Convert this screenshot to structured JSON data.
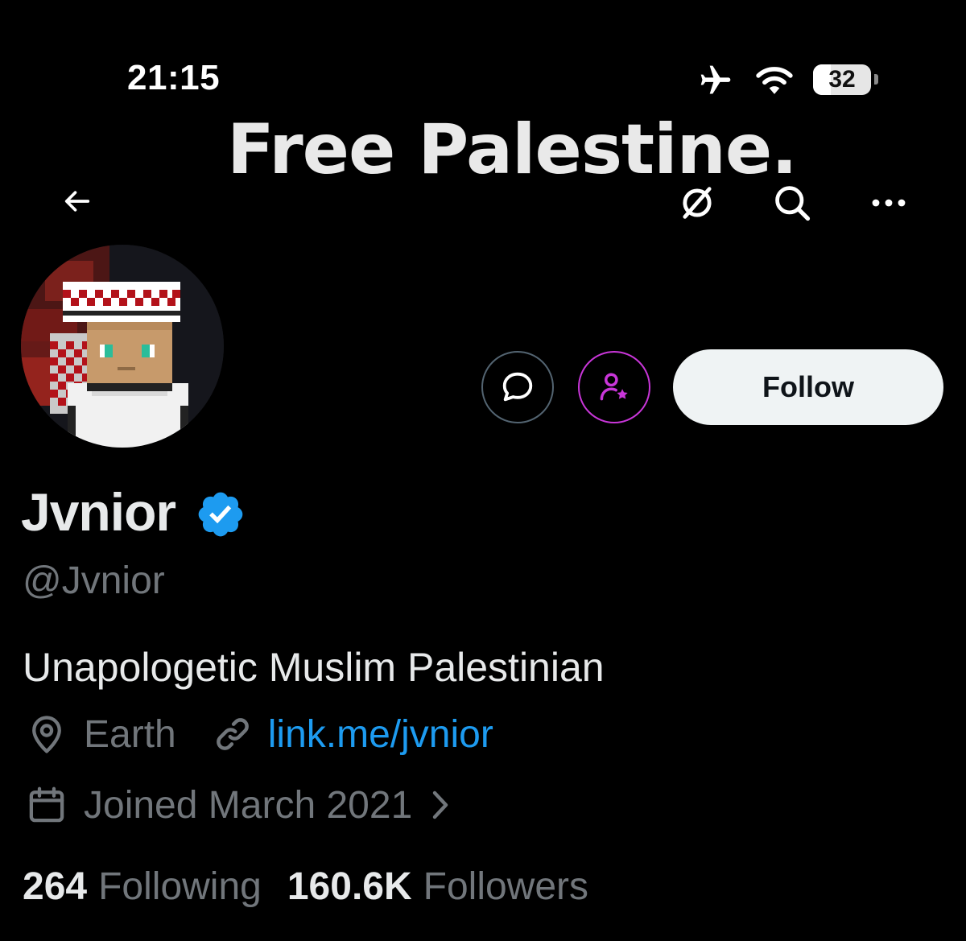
{
  "status_bar": {
    "time": "21:15",
    "battery": "32",
    "icons": [
      "airplane-icon",
      "wifi-icon",
      "battery-icon"
    ]
  },
  "banner": {
    "text": "Free Palestine."
  },
  "header": {
    "icons": [
      "back-arrow-icon",
      "translate-icon",
      "search-icon",
      "more-icon"
    ]
  },
  "profile": {
    "display_name": "Jvnior",
    "handle": "@Jvnior",
    "bio": "Unapologetic Muslim Palestinian",
    "location": "Earth",
    "website": "link.me/jvnior",
    "joined": "Joined March 2021",
    "following_count": "264",
    "following_label": "Following",
    "followers_count": "160.6K",
    "followers_label": "Followers"
  },
  "actions": {
    "follow_label": "Follow",
    "icons": [
      "message-icon",
      "subscribe-icon"
    ]
  },
  "colors": {
    "background": "#000000",
    "primary_text": "#e7e9ea",
    "secondary_text": "#71767b",
    "link": "#1d9bf0",
    "verified": "#1d9bf0",
    "subscribe_accent": "#c936d9",
    "follow_button_bg": "#eff3f4"
  }
}
